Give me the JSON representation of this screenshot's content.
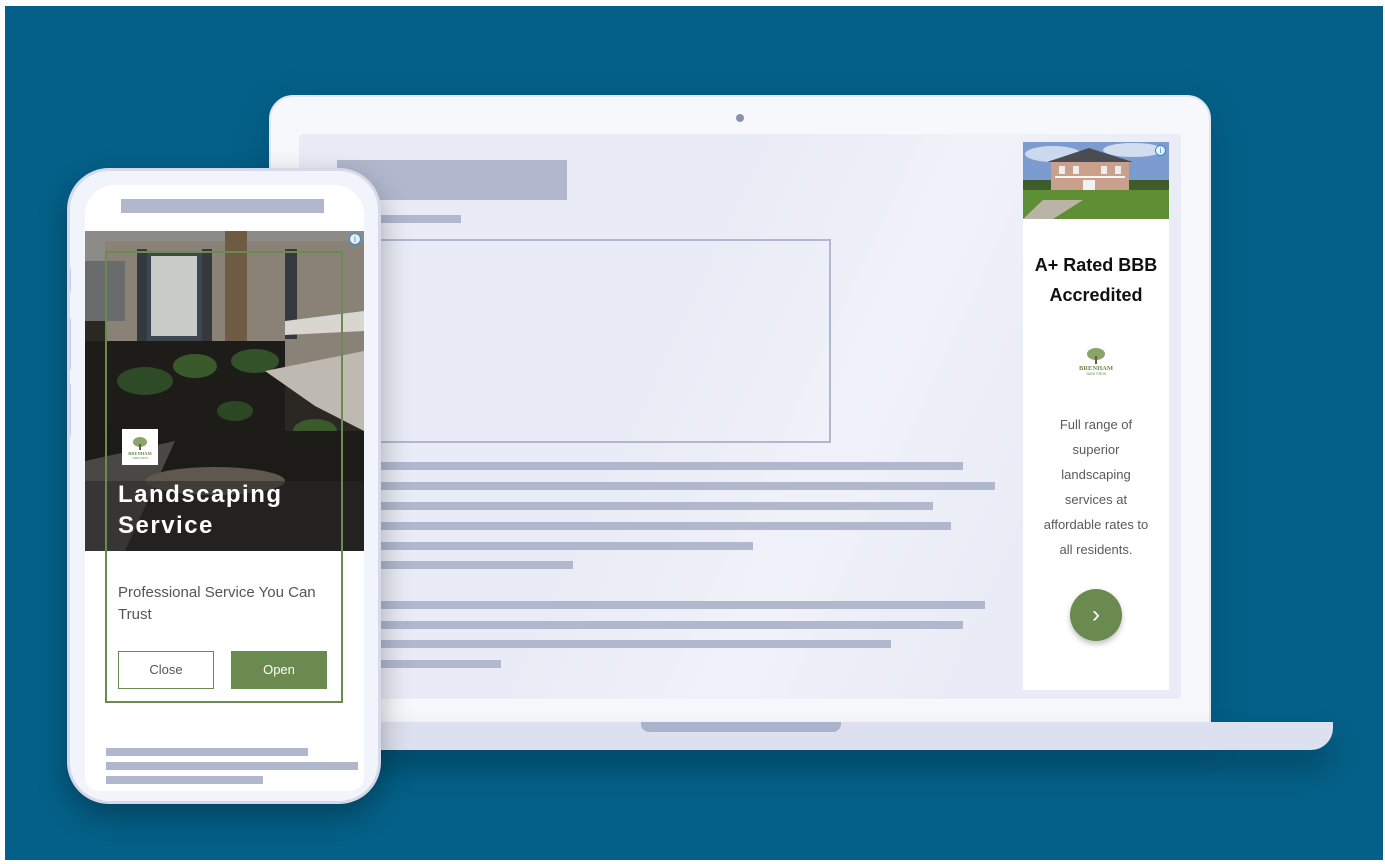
{
  "desktop_ad": {
    "headline": "A+ Rated BBB Accredited",
    "brand_logo_text": "BRENHAM YARD PROS",
    "body": "Full range of superior landscaping services at affordable rates to all residents.",
    "cta_icon": "chevron-right-icon",
    "info_icon": "info-icon",
    "info_glyph": "i",
    "arrow_glyph": "›"
  },
  "mobile_ad": {
    "headline": "Landscaping Service",
    "body": "Professional Service You Can Trust",
    "close_label": "Close",
    "open_label": "Open",
    "info_icon": "info-icon",
    "info_glyph": "i",
    "brand_logo_text": "BRENHAM YARD PROS"
  },
  "colors": {
    "background": "#046088",
    "accent_green": "#6b8a4f",
    "placeholder": "#b1b8cd"
  }
}
